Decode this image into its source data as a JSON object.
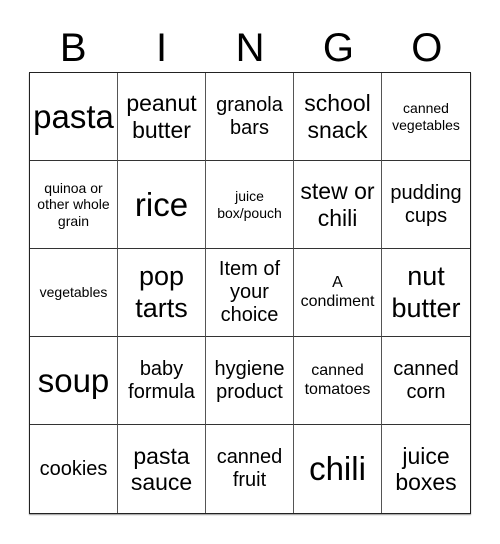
{
  "header": [
    "B",
    "I",
    "N",
    "G",
    "O"
  ],
  "cells": [
    "pasta",
    "peanut butter",
    "granola bars",
    "school snack",
    "canned vegetables",
    "quinoa or other whole grain",
    "rice",
    "juice box/pouch",
    "stew or chili",
    "pudding cups",
    "vegetables",
    "pop tarts",
    "Item of your choice",
    "A condiment",
    "nut butter",
    "soup",
    "baby formula",
    "hygiene product",
    "canned tomatoes",
    "canned corn",
    "cookies",
    "pasta sauce",
    "canned fruit",
    "chili",
    "juice boxes"
  ]
}
